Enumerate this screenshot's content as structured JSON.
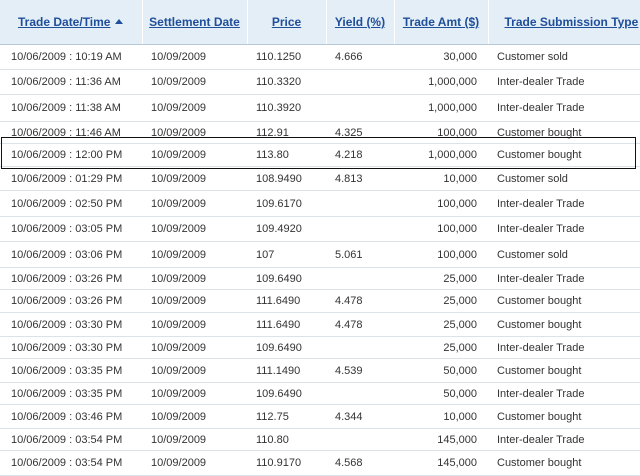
{
  "columns": {
    "trade_date": "Trade Date/Time",
    "settlement_date": "Settlement Date",
    "price": "Price",
    "yield": "Yield (%)",
    "trade_amt": "Trade Amt ($)",
    "submission_type": "Trade Submission Type"
  },
  "sort": {
    "column": "trade_date",
    "direction": "ascending",
    "icon": "sort-ascending-icon"
  },
  "rows": [
    {
      "trade_date": "10/06/2009 : 10:19 AM",
      "settlement_date": "10/09/2009",
      "price": "110.1250",
      "yield": "4.666",
      "trade_amt": "30,000",
      "submission_type": "Customer sold"
    },
    {
      "trade_date": "10/06/2009 : 11:36 AM",
      "settlement_date": "10/09/2009",
      "price": "110.3320",
      "yield": "",
      "trade_amt": "1,000,000",
      "submission_type": "Inter-dealer Trade"
    },
    {
      "trade_date": "10/06/2009 : 11:38 AM",
      "settlement_date": "10/09/2009",
      "price": "110.3920",
      "yield": "",
      "trade_amt": "1,000,000",
      "submission_type": "Inter-dealer Trade"
    },
    {
      "trade_date": "10/06/2009 : 11:46 AM",
      "settlement_date": "10/09/2009",
      "price": "112.91",
      "yield": "4.325",
      "trade_amt": "100,000",
      "submission_type": "Customer bought"
    },
    {
      "trade_date": "10/06/2009 : 12:00 PM",
      "settlement_date": "10/09/2009",
      "price": "113.80",
      "yield": "4.218",
      "trade_amt": "1,000,000",
      "submission_type": "Customer bought"
    },
    {
      "trade_date": "10/06/2009 : 01:29 PM",
      "settlement_date": "10/09/2009",
      "price": "108.9490",
      "yield": "4.813",
      "trade_amt": "10,000",
      "submission_type": "Customer sold"
    },
    {
      "trade_date": "10/06/2009 : 02:50 PM",
      "settlement_date": "10/09/2009",
      "price": "109.6170",
      "yield": "",
      "trade_amt": "100,000",
      "submission_type": "Inter-dealer Trade"
    },
    {
      "trade_date": "10/06/2009 : 03:05 PM",
      "settlement_date": "10/09/2009",
      "price": "109.4920",
      "yield": "",
      "trade_amt": "100,000",
      "submission_type": "Inter-dealer Trade"
    },
    {
      "trade_date": "10/06/2009 : 03:06 PM",
      "settlement_date": "10/09/2009",
      "price": "107",
      "yield": "5.061",
      "trade_amt": "100,000",
      "submission_type": "Customer sold"
    },
    {
      "trade_date": "10/06/2009 : 03:26 PM",
      "settlement_date": "10/09/2009",
      "price": "109.6490",
      "yield": "",
      "trade_amt": "25,000",
      "submission_type": "Inter-dealer Trade"
    },
    {
      "trade_date": "10/06/2009 : 03:26 PM",
      "settlement_date": "10/09/2009",
      "price": "111.6490",
      "yield": "4.478",
      "trade_amt": "25,000",
      "submission_type": "Customer bought"
    },
    {
      "trade_date": "10/06/2009 : 03:30 PM",
      "settlement_date": "10/09/2009",
      "price": "111.6490",
      "yield": "4.478",
      "trade_amt": "25,000",
      "submission_type": "Customer bought"
    },
    {
      "trade_date": "10/06/2009 : 03:30 PM",
      "settlement_date": "10/09/2009",
      "price": "109.6490",
      "yield": "",
      "trade_amt": "25,000",
      "submission_type": "Inter-dealer Trade"
    },
    {
      "trade_date": "10/06/2009 : 03:35 PM",
      "settlement_date": "10/09/2009",
      "price": "111.1490",
      "yield": "4.539",
      "trade_amt": "50,000",
      "submission_type": "Customer bought"
    },
    {
      "trade_date": "10/06/2009 : 03:35 PM",
      "settlement_date": "10/09/2009",
      "price": "109.6490",
      "yield": "",
      "trade_amt": "50,000",
      "submission_type": "Inter-dealer Trade"
    },
    {
      "trade_date": "10/06/2009 : 03:46 PM",
      "settlement_date": "10/09/2009",
      "price": "112.75",
      "yield": "4.344",
      "trade_amt": "10,000",
      "submission_type": "Customer bought"
    },
    {
      "trade_date": "10/06/2009 : 03:54 PM",
      "settlement_date": "10/09/2009",
      "price": "110.80",
      "yield": "",
      "trade_amt": "145,000",
      "submission_type": "Inter-dealer Trade"
    },
    {
      "trade_date": "10/06/2009 : 03:54 PM",
      "settlement_date": "10/09/2009",
      "price": "110.9170",
      "yield": "4.568",
      "trade_amt": "145,000",
      "submission_type": "Customer bought"
    }
  ],
  "highlighted_row": 4,
  "colors": {
    "header_bg": "#e3eef6",
    "header_text": "#1f4e9a",
    "row_border": "#dbe3ea"
  }
}
